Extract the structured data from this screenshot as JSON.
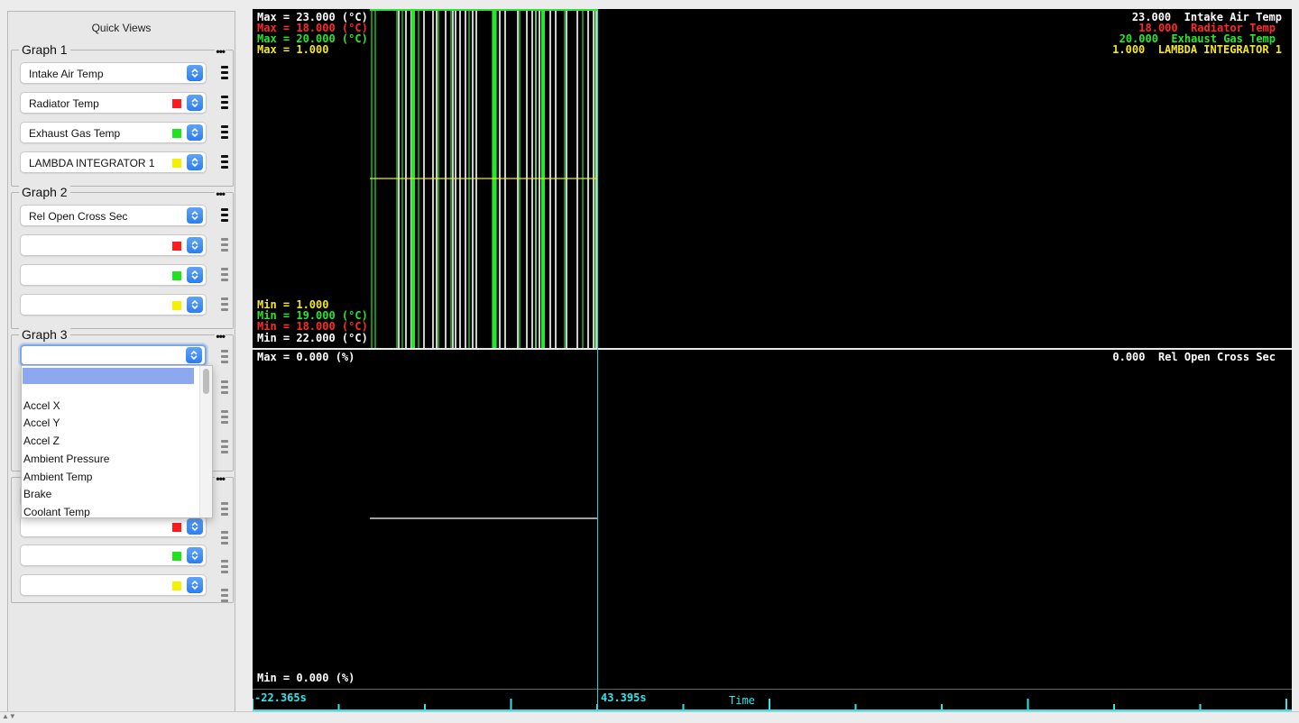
{
  "quick_views_title": "Quick Views",
  "colors": {
    "white": "#ffffff",
    "red": "#ff2a2a",
    "green": "#27e62b",
    "yellow": "#f4e81c",
    "cyan": "#2ee6ea",
    "swatch_red": "#ff1c1c",
    "swatch_green": "#1ee41e",
    "swatch_yellow": "#f4f000"
  },
  "groups": [
    {
      "title": "Graph 1",
      "menu": "•••",
      "rows": [
        {
          "label": "Intake Air Temp",
          "swatch": ""
        },
        {
          "label": "Radiator Temp",
          "swatch": "red"
        },
        {
          "label": "Exhaust Gas Temp",
          "swatch": "green"
        },
        {
          "label": "LAMBDA INTEGRATOR 1",
          "swatch": "yellow"
        }
      ]
    },
    {
      "title": "Graph 2",
      "menu": "•••",
      "rows": [
        {
          "label": "Rel Open Cross Sec",
          "swatch": ""
        },
        {
          "label": "",
          "swatch": "red"
        },
        {
          "label": "",
          "swatch": "green"
        },
        {
          "label": "",
          "swatch": "yellow"
        }
      ]
    },
    {
      "title": "Graph 3",
      "menu": "•••",
      "rows": [
        {
          "label": "",
          "swatch": ""
        }
      ]
    },
    {
      "title": "",
      "menu": "•••",
      "rows": [
        {
          "label": "",
          "swatch": ""
        },
        {
          "label": "",
          "swatch": "red"
        },
        {
          "label": "",
          "swatch": "green"
        },
        {
          "label": "",
          "swatch": "yellow"
        }
      ]
    }
  ],
  "dropdown": {
    "selected": "",
    "options": [
      "Accel X",
      "Accel Y",
      "Accel Z",
      "Ambient Pressure",
      "Ambient Temp",
      "Brake",
      "Coolant Temp"
    ]
  },
  "graph1": {
    "max_labels": [
      {
        "text": "Max = 23.000 (°C)",
        "color": "white"
      },
      {
        "text": "Max = 18.000 (°C)",
        "color": "red"
      },
      {
        "text": "Max = 20.000 (°C)",
        "color": "green"
      },
      {
        "text": "Max = 1.000",
        "color": "yellow"
      }
    ],
    "min_labels": [
      {
        "text": "Min = 1.000",
        "color": "yellow"
      },
      {
        "text": "Min = 19.000 (°C)",
        "color": "green"
      },
      {
        "text": "Min = 18.000 (°C)",
        "color": "red"
      },
      {
        "text": "Min = 22.000 (°C)",
        "color": "white"
      }
    ],
    "legend": [
      {
        "value": "23.000",
        "name": "Intake Air Temp",
        "color": "white"
      },
      {
        "value": "18.000",
        "name": "Radiator Temp",
        "color": "red"
      },
      {
        "value": "20.000",
        "name": "Exhaust Gas Temp",
        "color": "green"
      },
      {
        "value": "1.000",
        "name": "LAMBDA INTEGRATOR 1",
        "color": "yellow"
      }
    ]
  },
  "graph2": {
    "max_label": "Max = 0.000 (%)",
    "min_label": "Min = 0.000 (%)",
    "legend": {
      "value": "0.000",
      "name": "Rel Open Cross Sec"
    }
  },
  "timebar": {
    "start": "-22.365s",
    "cursor": "43.395s",
    "title": "Time"
  }
}
